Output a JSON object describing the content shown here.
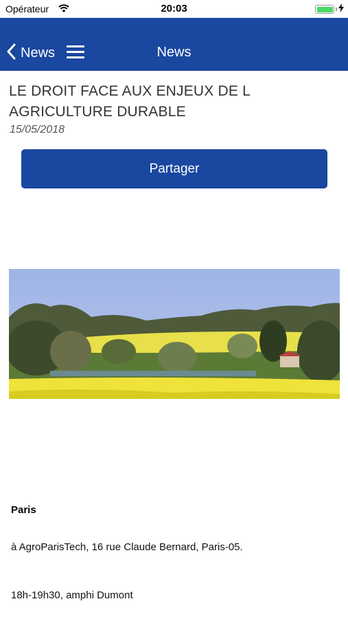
{
  "status_bar": {
    "carrier": "Opérateur",
    "time": "20:03",
    "battery_level": 1.0,
    "battery_color": "#4cd964",
    "icons": [
      "wifi-icon",
      "battery-icon",
      "charging-bolt-icon"
    ]
  },
  "navbar": {
    "background": "#1a47a0",
    "back_label": "News",
    "back_icon": "chevron-left-icon",
    "menu_icon": "hamburger-menu-icon",
    "title": "News"
  },
  "article": {
    "title": "LE DROIT FACE AUX ENJEUX DE L AGRICULTURE DURABLE",
    "date": "15/05/2018",
    "share_label": "Partager",
    "image": "landscape-photo",
    "city": "Paris",
    "address": "à AgroParisTech, 16 rue Claude Bernard, Paris-05.",
    "schedule": "18h-19h30, amphi Dumont"
  }
}
